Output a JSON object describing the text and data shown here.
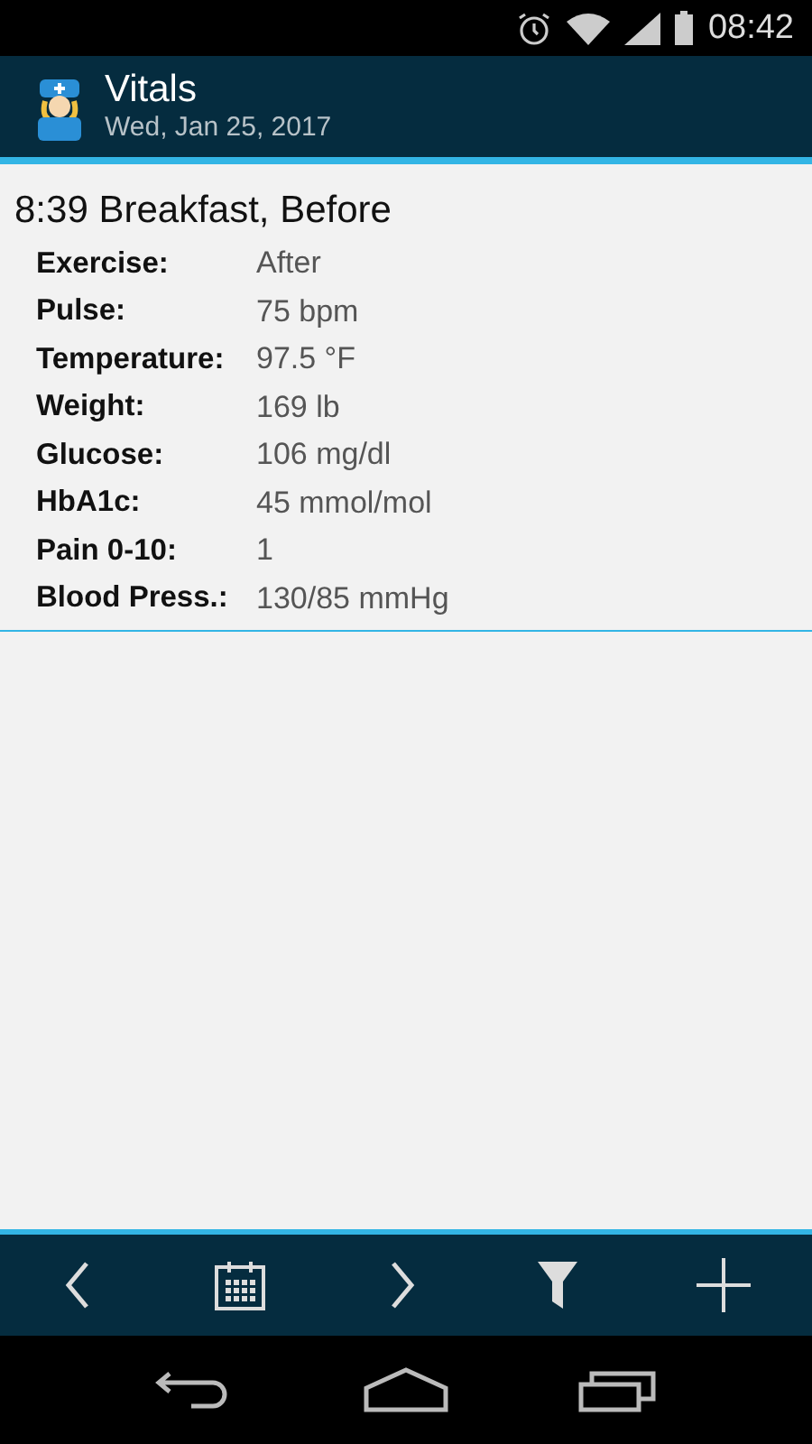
{
  "status_bar": {
    "time": "08:42"
  },
  "app_bar": {
    "title": "Vitals",
    "subtitle": "Wed, Jan 25, 2017"
  },
  "entry": {
    "heading": "8:39 Breakfast, Before",
    "rows": [
      {
        "label": "Exercise:",
        "value": "After"
      },
      {
        "label": "Pulse:",
        "value": "75 bpm"
      },
      {
        "label": "Temperature:",
        "value": "97.5 °F"
      },
      {
        "label": "Weight:",
        "value": "169 lb"
      },
      {
        "label": "Glucose:",
        "value": "106 mg/dl"
      },
      {
        "label": "HbA1c:",
        "value": "45 mmol/mol"
      },
      {
        "label": "Pain 0-10:",
        "value": "1"
      },
      {
        "label": "Blood Press.:",
        "value": "130/85 mmHg"
      }
    ]
  }
}
